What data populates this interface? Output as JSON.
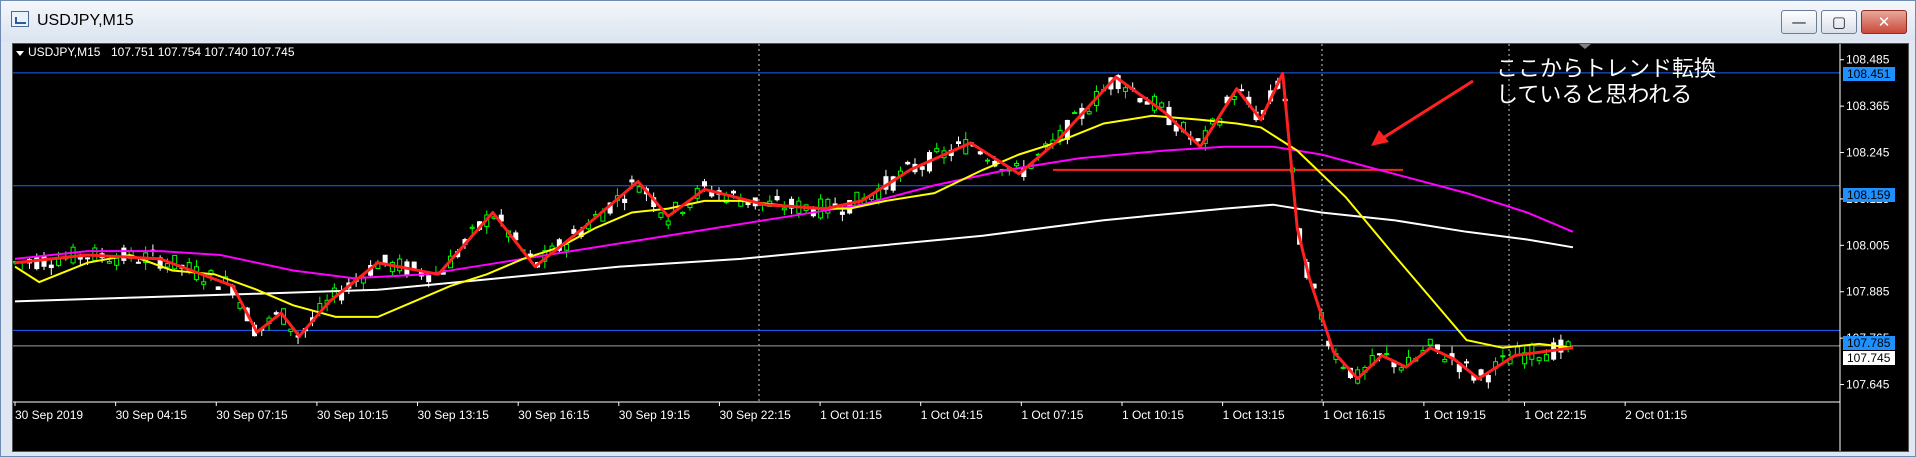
{
  "window": {
    "title": "USDJPY,M15",
    "buttons": {
      "minimize": "—",
      "restore": "▢",
      "close": "✕"
    }
  },
  "chart_info": {
    "symbol": "USDJPY,M15",
    "ohlc": "107.751 107.754 107.740 107.745"
  },
  "annotation": {
    "line1": "ここからトレンド転換",
    "line2": "していると思われる"
  },
  "price_tags": {
    "level_1": "108.451",
    "level_2": "108.159",
    "level_3": "107.785",
    "current": "107.745"
  },
  "colors": {
    "background": "#000000",
    "bull": "#00ff00",
    "bear": "#ffffff",
    "ma_fast": "#ffff00",
    "ma_mid": "#ff00ff",
    "ma_slow": "#ffffff",
    "trend_line": "#ff2020",
    "hline": "#1e64ff",
    "tag_blue": "#1e90ff"
  },
  "chart_data": {
    "type": "candlestick",
    "y_ticks": [
      "108.485",
      "108.365",
      "108.245",
      "108.125",
      "108.005",
      "107.885",
      "107.765",
      "107.645"
    ],
    "x_ticks": [
      "30 Sep 2019",
      "30 Sep 04:15",
      "30 Sep 07:15",
      "30 Sep 10:15",
      "30 Sep 13:15",
      "30 Sep 16:15",
      "30 Sep 19:15",
      "30 Sep 22:15",
      "1 Oct 01:15",
      "1 Oct 04:15",
      "1 Oct 07:15",
      "1 Oct 10:15",
      "1 Oct 13:15",
      "1 Oct 16:15",
      "1 Oct 19:15",
      "1 Oct 22:15",
      "2 Oct 01:15"
    ],
    "ylim": [
      107.605,
      108.505
    ],
    "horizontal_levels": [
      108.451,
      108.159,
      107.785
    ],
    "current_price": 107.745,
    "red_support_line": 108.2,
    "ma_fast": [
      [
        0,
        107.95
      ],
      [
        20,
        107.91
      ],
      [
        60,
        107.96
      ],
      [
        95,
        107.98
      ],
      [
        130,
        107.94
      ],
      [
        165,
        107.93
      ],
      [
        200,
        107.89
      ],
      [
        230,
        107.85
      ],
      [
        265,
        107.82
      ],
      [
        300,
        107.82
      ],
      [
        330,
        107.86
      ],
      [
        360,
        107.9
      ],
      [
        390,
        107.93
      ],
      [
        420,
        107.97
      ],
      [
        450,
        108.0
      ],
      [
        480,
        108.05
      ],
      [
        510,
        108.09
      ],
      [
        540,
        108.1
      ],
      [
        570,
        108.12
      ],
      [
        600,
        108.12
      ],
      [
        630,
        108.11
      ],
      [
        660,
        108.1
      ],
      [
        690,
        108.1
      ],
      [
        720,
        108.12
      ],
      [
        760,
        108.14
      ],
      [
        800,
        108.2
      ],
      [
        830,
        108.24
      ],
      [
        860,
        108.27
      ],
      [
        900,
        108.32
      ],
      [
        940,
        108.34
      ],
      [
        980,
        108.33
      ],
      [
        1010,
        108.32
      ],
      [
        1030,
        108.31
      ],
      [
        1060,
        108.25
      ],
      [
        1100,
        108.13
      ],
      [
        1140,
        107.98
      ],
      [
        1170,
        107.87
      ],
      [
        1200,
        107.76
      ],
      [
        1230,
        107.74
      ],
      [
        1260,
        107.75
      ],
      [
        1288,
        107.74
      ]
    ],
    "ma_mid": [
      [
        0,
        107.97
      ],
      [
        60,
        107.99
      ],
      [
        120,
        107.99
      ],
      [
        170,
        107.98
      ],
      [
        230,
        107.94
      ],
      [
        280,
        107.92
      ],
      [
        340,
        107.93
      ],
      [
        400,
        107.96
      ],
      [
        460,
        107.99
      ],
      [
        520,
        108.02
      ],
      [
        580,
        108.05
      ],
      [
        640,
        108.08
      ],
      [
        700,
        108.11
      ],
      [
        760,
        108.16
      ],
      [
        820,
        108.2
      ],
      [
        880,
        108.23
      ],
      [
        950,
        108.25
      ],
      [
        1000,
        108.26
      ],
      [
        1040,
        108.26
      ],
      [
        1080,
        108.24
      ],
      [
        1140,
        108.19
      ],
      [
        1200,
        108.14
      ],
      [
        1250,
        108.09
      ],
      [
        1288,
        108.04
      ]
    ],
    "ma_slow": [
      [
        0,
        107.86
      ],
      [
        100,
        107.87
      ],
      [
        200,
        107.88
      ],
      [
        300,
        107.89
      ],
      [
        400,
        107.92
      ],
      [
        500,
        107.95
      ],
      [
        600,
        107.97
      ],
      [
        700,
        108.0
      ],
      [
        800,
        108.03
      ],
      [
        900,
        108.07
      ],
      [
        1000,
        108.1
      ],
      [
        1040,
        108.11
      ],
      [
        1080,
        108.09
      ],
      [
        1140,
        108.07
      ],
      [
        1200,
        108.04
      ],
      [
        1250,
        108.02
      ],
      [
        1288,
        108.0
      ]
    ],
    "red_zigzag": [
      [
        0,
        107.96
      ],
      [
        60,
        107.98
      ],
      [
        120,
        107.97
      ],
      [
        180,
        107.9
      ],
      [
        200,
        107.78
      ],
      [
        220,
        107.83
      ],
      [
        235,
        107.77
      ],
      [
        260,
        107.86
      ],
      [
        300,
        107.96
      ],
      [
        350,
        107.93
      ],
      [
        395,
        108.09
      ],
      [
        430,
        107.95
      ],
      [
        470,
        108.05
      ],
      [
        515,
        108.17
      ],
      [
        540,
        108.08
      ],
      [
        570,
        108.15
      ],
      [
        620,
        108.11
      ],
      [
        670,
        108.1
      ],
      [
        700,
        108.12
      ],
      [
        740,
        108.2
      ],
      [
        790,
        108.27
      ],
      [
        830,
        108.19
      ],
      [
        860,
        108.27
      ],
      [
        910,
        108.44
      ],
      [
        950,
        108.35
      ],
      [
        980,
        108.26
      ],
      [
        1010,
        108.41
      ],
      [
        1030,
        108.33
      ],
      [
        1048,
        108.45
      ],
      [
        1060,
        108.05
      ],
      [
        1070,
        107.92
      ],
      [
        1090,
        107.73
      ],
      [
        1110,
        107.66
      ],
      [
        1130,
        107.72
      ],
      [
        1150,
        107.69
      ],
      [
        1170,
        107.74
      ],
      [
        1190,
        107.71
      ],
      [
        1210,
        107.66
      ],
      [
        1240,
        107.72
      ],
      [
        1288,
        107.74
      ]
    ]
  }
}
